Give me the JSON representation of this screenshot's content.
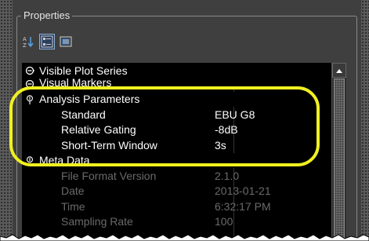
{
  "panel": {
    "title": "Properties"
  },
  "toolbar": {
    "buttons": [
      {
        "icon": "sort-alpha-icon",
        "active": false
      },
      {
        "icon": "categorized-icon",
        "active": true
      },
      {
        "icon": "list-view-icon",
        "active": false
      }
    ]
  },
  "categories": [
    {
      "label": "Visible Plot Series",
      "expanded": false
    },
    {
      "label": "Visual Markers",
      "expanded": false
    },
    {
      "label": "Analysis Parameters",
      "expanded": true
    },
    {
      "label": "Meta Data",
      "expanded": true
    }
  ],
  "analysis_parameters": [
    {
      "name": "Standard",
      "value": "EBU G8"
    },
    {
      "name": "Relative Gating",
      "value": "-8dB"
    },
    {
      "name": "Short-Term Window",
      "value": "3s"
    }
  ],
  "meta_data": [
    {
      "name": "File Format Version",
      "value": "2.1.0"
    },
    {
      "name": "Date",
      "value": "2013-01-21"
    },
    {
      "name": "Time",
      "value": "6:32:17 PM"
    },
    {
      "name": "Sampling Rate",
      "value": "100"
    }
  ],
  "colors": {
    "highlight": "#f0f020",
    "background": "#000000",
    "panel": "#3f3f3f"
  }
}
